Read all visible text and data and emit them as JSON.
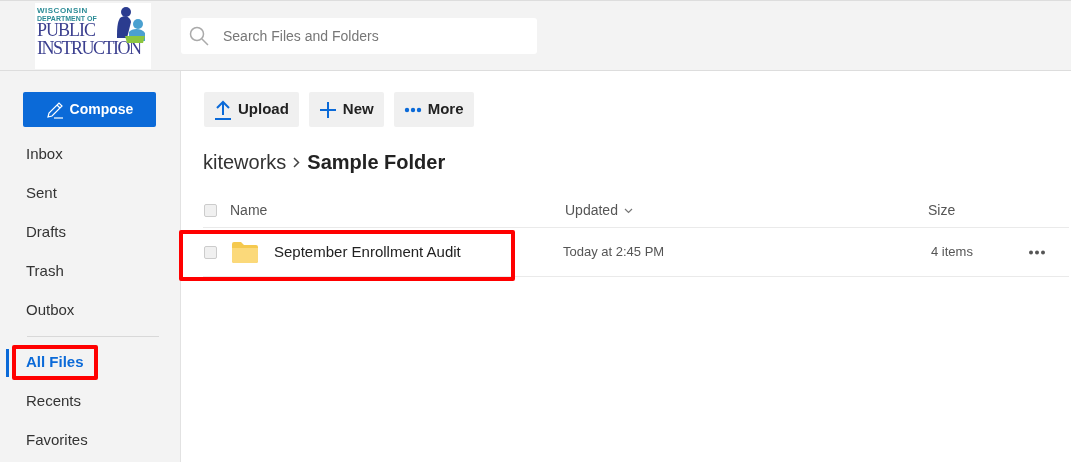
{
  "logo": {
    "line_1": "WISCONSIN",
    "line_2": "DEPARTMENT OF",
    "line_3": "PUBLIC",
    "line_4": "INSTRUCTION"
  },
  "search": {
    "placeholder": "Search Files and Folders"
  },
  "compose": {
    "label": "Compose"
  },
  "sidebar": {
    "mail_items": [
      {
        "label": "Inbox",
        "selected": false,
        "highlighted": false
      },
      {
        "label": "Sent",
        "selected": false,
        "highlighted": false
      },
      {
        "label": "Drafts",
        "selected": false,
        "highlighted": false
      },
      {
        "label": "Trash",
        "selected": false,
        "highlighted": false
      },
      {
        "label": "Outbox",
        "selected": false,
        "highlighted": false
      }
    ],
    "file_items": [
      {
        "label": "All Files",
        "selected": true,
        "highlighted": true
      },
      {
        "label": "Recents",
        "selected": false,
        "highlighted": false
      },
      {
        "label": "Favorites",
        "selected": false,
        "highlighted": false
      }
    ]
  },
  "toolbar": [
    {
      "kind": "upload",
      "label": "Upload"
    },
    {
      "kind": "new",
      "label": "New"
    },
    {
      "kind": "more",
      "label": "More"
    }
  ],
  "breadcrumb": [
    {
      "label": "kiteworks",
      "selected": false
    },
    {
      "label": "Sample Folder",
      "selected": true
    }
  ],
  "table": {
    "columns": [
      {
        "label": "Name",
        "sorted": false
      },
      {
        "label": "Updated",
        "sorted": true
      },
      {
        "label": "Size",
        "sorted": false
      }
    ],
    "all_checked": false,
    "rows": [
      {
        "name": "September Enrollment Audit",
        "updated": "Today at 2:45 PM",
        "size": "4 items",
        "checked": false,
        "highlighted": true
      }
    ]
  }
}
